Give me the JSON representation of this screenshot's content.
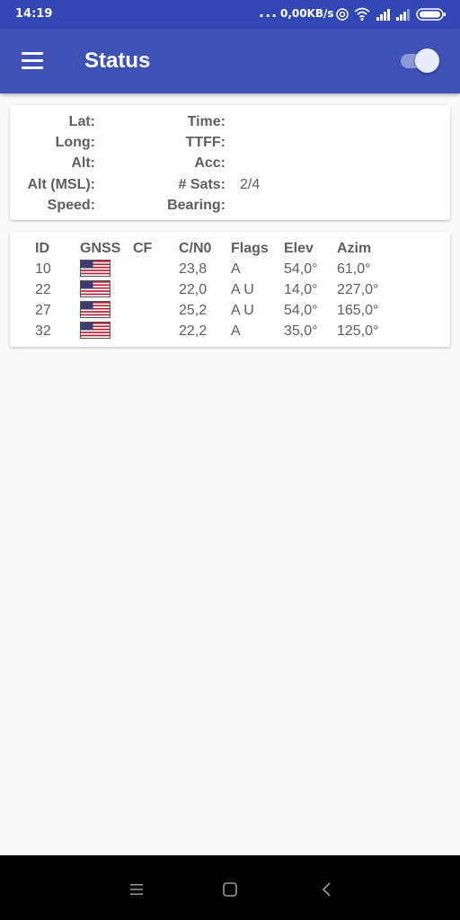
{
  "status_bar": {
    "time": "14:19",
    "more": "...",
    "net_speed": "0,00KB/s",
    "icons": [
      "hotspot-icon",
      "wifi-icon",
      "signal-icon",
      "signal-icon",
      "battery-icon"
    ]
  },
  "app_bar": {
    "title": "Status",
    "menu_icon": "hamburger-menu-icon",
    "toggle_state": "on"
  },
  "location": {
    "labels": {
      "lat": "Lat:",
      "long": "Long:",
      "alt": "Alt:",
      "alt_msl": "Alt (MSL):",
      "speed": "Speed:",
      "time": "Time:",
      "ttff": "TTFF:",
      "acc": "Acc:",
      "num_sats": "# Sats:",
      "bearing": "Bearing:"
    },
    "values": {
      "num_sats": "2/4"
    }
  },
  "satellites": {
    "headers": {
      "id": "ID",
      "gnss": "GNSS",
      "cf": "CF",
      "cn0": "C/N0",
      "flags": "Flags",
      "elev": "Elev",
      "azim": "Azim"
    },
    "rows": [
      {
        "id": "10",
        "gnss": "us-flag-icon",
        "cf": "",
        "cn0": "23,8",
        "flags": "A",
        "elev": "54,0°",
        "azim": "61,0°"
      },
      {
        "id": "22",
        "gnss": "us-flag-icon",
        "cf": "",
        "cn0": "22,0",
        "flags": "A U",
        "elev": "14,0°",
        "azim": "227,0°"
      },
      {
        "id": "27",
        "gnss": "us-flag-icon",
        "cf": "",
        "cn0": "25,2",
        "flags": "A U",
        "elev": "54,0°",
        "azim": "165,0°"
      },
      {
        "id": "32",
        "gnss": "us-flag-icon",
        "cf": "",
        "cn0": "22,2",
        "flags": "A",
        "elev": "35,0°",
        "azim": "125,0°"
      }
    ]
  },
  "nav_bar": {
    "icons": [
      "recents-icon",
      "home-icon",
      "back-icon"
    ]
  },
  "colors": {
    "primary": "#3f51b5",
    "primary_dark": "#3346b5",
    "text": "#5f5f5f",
    "background": "#fafafa"
  }
}
